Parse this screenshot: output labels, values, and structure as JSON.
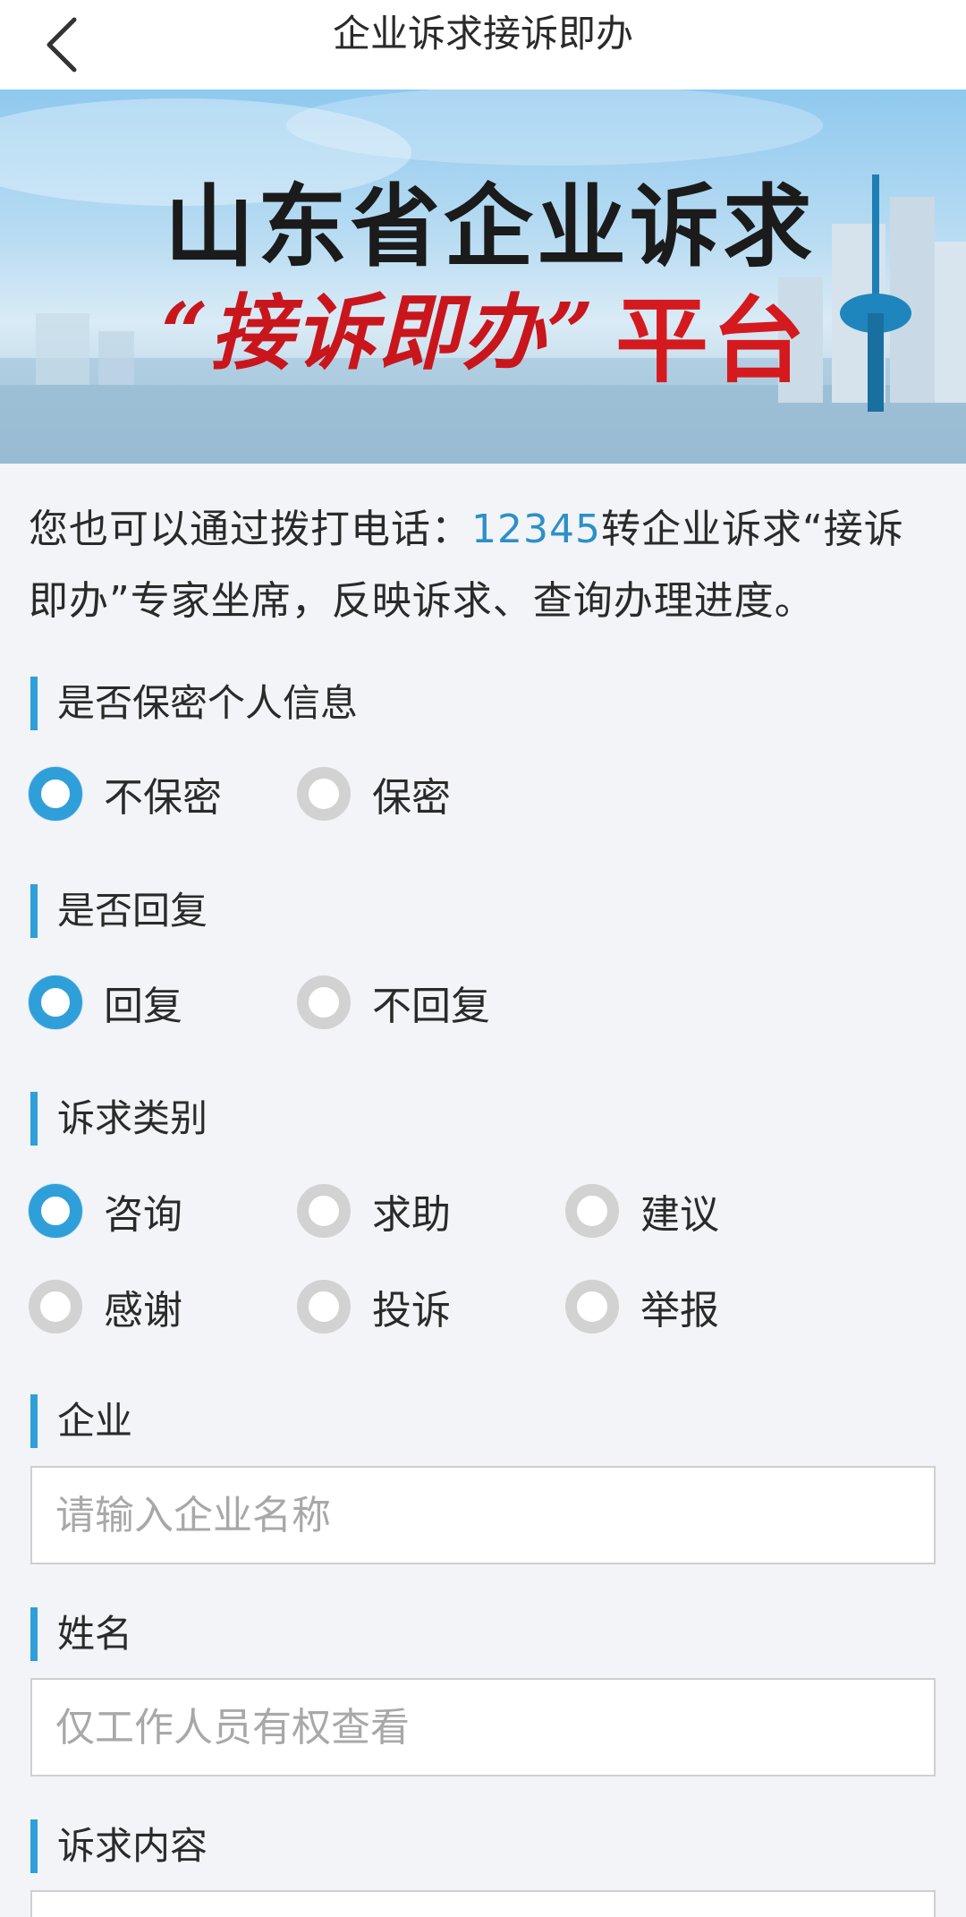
{
  "header": {
    "title": "企业诉求接诉即办",
    "back_icon": "chevron-left-icon"
  },
  "banner": {
    "line1": "山东省企业诉求",
    "line2": "“接诉即办”",
    "line3": "平台"
  },
  "intro": {
    "prefix": "您也可以通过拨打电话：",
    "phone": "12345",
    "suffix": "转企业诉求“接诉即办”专家坐席，反映诉求、查询办理进度。"
  },
  "privacy": {
    "label": "是否保密个人信息",
    "options": [
      {
        "label": "不保密",
        "selected": true
      },
      {
        "label": "保密",
        "selected": false
      }
    ]
  },
  "reply": {
    "label": "是否回复",
    "options": [
      {
        "label": "回复",
        "selected": true
      },
      {
        "label": "不回复",
        "selected": false
      }
    ]
  },
  "category": {
    "label": "诉求类别",
    "options": [
      {
        "label": "咨询",
        "selected": true
      },
      {
        "label": "求助",
        "selected": false
      },
      {
        "label": "建议",
        "selected": false
      },
      {
        "label": "感谢",
        "selected": false
      },
      {
        "label": "投诉",
        "selected": false
      },
      {
        "label": "举报",
        "selected": false
      }
    ]
  },
  "company": {
    "label": "企业",
    "placeholder": "请输入企业名称",
    "value": ""
  },
  "name": {
    "label": "姓名",
    "placeholder": "仅工作人员有权查看",
    "value": ""
  },
  "content": {
    "label": "诉求内容"
  },
  "colors": {
    "accent": "#2f9fda",
    "phone": "#2b90c8",
    "banner_red": "#c9161c"
  }
}
